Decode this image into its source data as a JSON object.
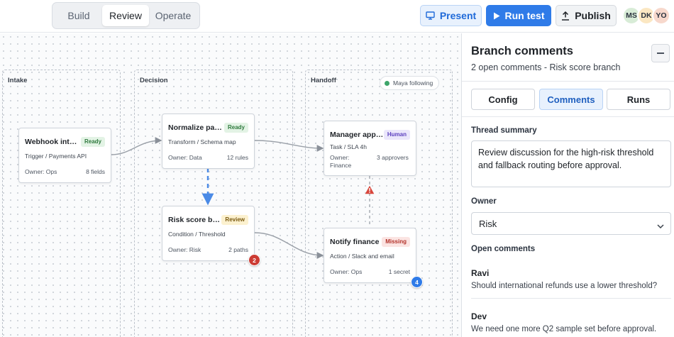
{
  "mode_tabs": [
    "Build",
    "Review",
    "Operate"
  ],
  "actions": {
    "present": "Present",
    "run_test": "Run test",
    "publish": "Publish"
  },
  "collaborators": [
    "MS",
    "DK",
    "YO"
  ],
  "lanes": [
    "Intake",
    "Decision",
    "Handoff"
  ],
  "presence": "Maya following",
  "nodes": {
    "webhook": {
      "title": "Webhook intake",
      "badge": "Ready",
      "subtitle": "Trigger / Payments API",
      "owner": "Owner: Ops",
      "meta": "8 fields"
    },
    "normalize": {
      "title": "Normalize payload",
      "badge": "Ready",
      "subtitle": "Transform / Schema map",
      "owner": "Owner: Data",
      "meta": "12 rules"
    },
    "risk": {
      "title": "Risk score branch",
      "badge": "Review",
      "subtitle": "Condition / Threshold",
      "owner": "Owner: Risk",
      "meta": "2 paths"
    },
    "manager": {
      "title": "Manager approval",
      "badge": "Human",
      "subtitle": "Task / SLA 4h",
      "owner": "Owner: Finance",
      "meta": "3 approvers"
    },
    "notify": {
      "title": "Notify finance",
      "badge": "Missing",
      "subtitle": "Action / Slack and email",
      "owner": "Owner: Ops",
      "meta": "1 secret"
    }
  },
  "comment_counts": {
    "risk": "2",
    "notify": "4"
  },
  "colors": {
    "accent": "#2f7be8",
    "ready": "#2f7a3e",
    "review": "#7a5a10",
    "human": "#5b3fbf",
    "missing": "#b3322a",
    "alert": "#cc3b33"
  },
  "panel": {
    "title": "Branch comments",
    "subtitle": "2 open comments - Risk score branch",
    "tabs": [
      "Config",
      "Comments",
      "Runs"
    ],
    "thread_summary_label": "Thread summary",
    "thread_summary": "Review discussion for the high-risk threshold and fallback routing before approval.",
    "owner_label": "Owner",
    "owner_value": "Risk",
    "open_comments_label": "Open comments",
    "comments": [
      {
        "author": "Ravi",
        "text": "Should international refunds use a lower threshold?"
      },
      {
        "author": "Dev",
        "text": "We need one more Q2 sample set before approval."
      }
    ]
  }
}
